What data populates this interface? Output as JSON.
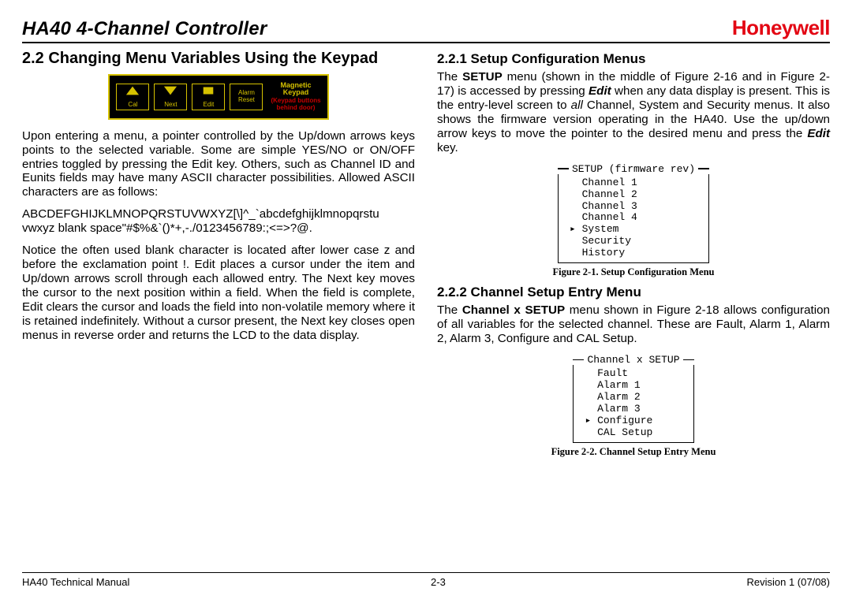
{
  "header": {
    "title": "HA40 4-Channel Controller",
    "brand": "Honeywell"
  },
  "left": {
    "heading": "2.2 Changing Menu Variables Using the Keypad",
    "keypad": {
      "btn_cal": "Cal",
      "btn_next": "Next",
      "btn_edit": "Edit",
      "btn_alarm": "Alarm",
      "btn_reset": "Reset",
      "side_title_a": "Magnetic",
      "side_title_b": "Keypad",
      "side_note_a": "(Keypad buttons",
      "side_note_b": "behind door)"
    },
    "p1": "Upon entering a menu, a pointer controlled by the Up/down arrows keys points to the selected variable. Some are simple YES/NO or ON/OFF entries toggled by pressing the Edit key. Others, such as Channel ID and Eunits fields may have many ASCII character possibilities. Allowed ASCII characters are as follows:",
    "ascii1": "ABCDEFGHIJKLMNOPQRSTUVWXYZ[\\]^_`abcdefghijklmnopqrstu",
    "ascii2": "vwxyz blank space\"#$%&`()*+,-./0123456789:;<=>?@.",
    "p2": "Notice the often used blank character is located after lower case z and before the exclamation point !.  Edit places a cursor under the item and Up/down arrows scroll through each allowed entry.  The Next key moves the cursor to the next position within a field.  When the field is complete, Edit clears the cursor and loads the field into non-volatile memory where it is retained indefinitely.  Without a cursor present, the Next key closes open menus in reverse order and returns the LCD to the data display."
  },
  "right": {
    "h1": "2.2.1 Setup Configuration Menus",
    "p1a": "The ",
    "p1b": "SETUP",
    "p1c": " menu (shown in the middle of Figure 2-16 and in Figure 2-17) is accessed by pressing ",
    "p1d": "Edit",
    "p1e": " when any data display is present. This is the entry-level screen to ",
    "p1f": "all",
    "p1g": " Channel, System and Security menus.  It also shows the firmware version operating in the HA40. Use the up/down arrow keys to move the pointer to the desired menu and press the ",
    "p1h": "Edit",
    "p1i": " key.",
    "lcd1": {
      "title": "SETUP (firmware rev)",
      "rows": [
        "Channel 1",
        "Channel 2",
        "Channel 3",
        "Channel 4",
        "System",
        "Security",
        "History"
      ],
      "selected": 4,
      "caption": "Figure 2-1. Setup Configuration Menu"
    },
    "h2": "2.2.2 Channel Setup Entry Menu",
    "p2a": "The ",
    "p2b": "Channel x SETUP",
    "p2c": " menu shown in Figure 2-18 allows configuration of all variables for the selected channel.  These are Fault, Alarm 1, Alarm 2, Alarm 3, Configure and CAL Setup.",
    "lcd2": {
      "title": "Channel x SETUP",
      "rows": [
        "Fault",
        "Alarm 1",
        "Alarm 2",
        "Alarm 3",
        "Configure",
        "CAL Setup"
      ],
      "selected": 4,
      "caption": "Figure 2-2. Channel Setup Entry Menu"
    }
  },
  "footer": {
    "left": "HA40 Technical Manual",
    "center": "2-3",
    "right": "Revision 1 (07/08)"
  }
}
